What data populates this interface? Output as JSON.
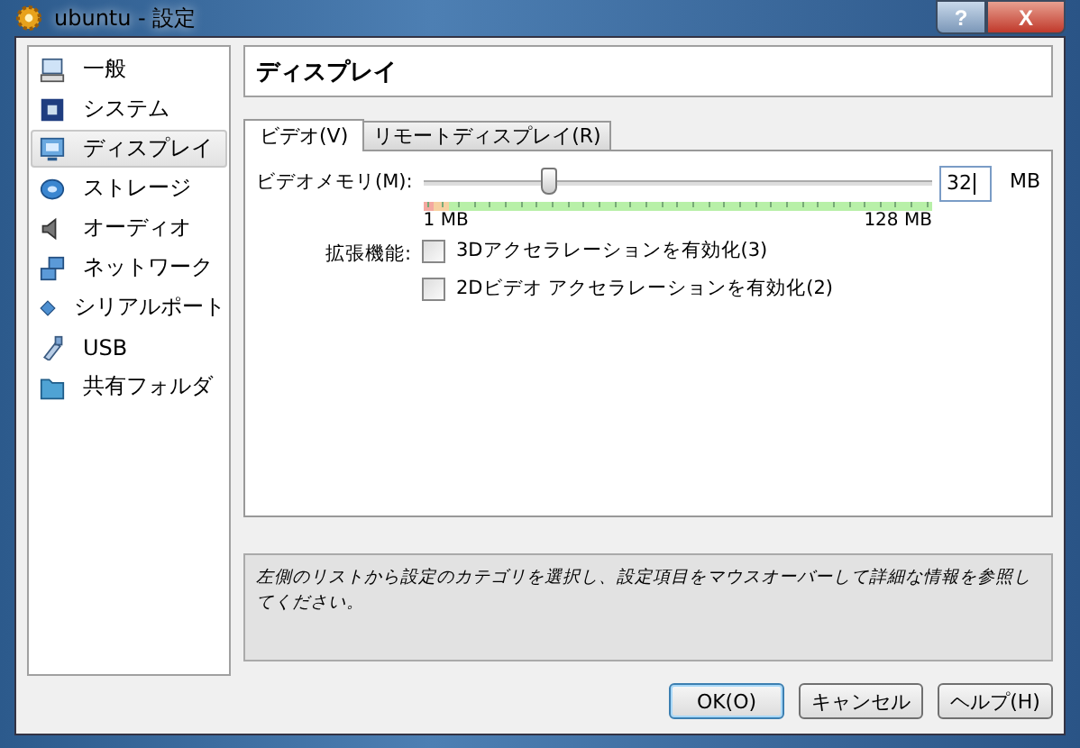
{
  "window": {
    "title": "ubuntu - 設定"
  },
  "title_buttons": [
    "?",
    "X"
  ],
  "sidebar": {
    "items": [
      {
        "label": "一般",
        "kind": "general",
        "selected": false
      },
      {
        "label": "システム",
        "kind": "system",
        "selected": false
      },
      {
        "label": "ディスプレイ",
        "kind": "display",
        "selected": true
      },
      {
        "label": "ストレージ",
        "kind": "storage",
        "selected": false
      },
      {
        "label": "オーディオ",
        "kind": "audio",
        "selected": false
      },
      {
        "label": "ネットワーク",
        "kind": "network",
        "selected": false
      },
      {
        "label": "シリアルポート",
        "kind": "serial",
        "selected": false
      },
      {
        "label": "USB",
        "kind": "usb",
        "selected": false
      },
      {
        "label": "共有フォルダ",
        "kind": "folder",
        "selected": false
      }
    ]
  },
  "page_title": "ディスプレイ",
  "tabs": [
    {
      "label": "ビデオ(V)",
      "selected": true
    },
    {
      "label": "リモートディスプレイ(R)",
      "selected": false
    }
  ],
  "video_memory": {
    "label": "ビデオメモリ(M):",
    "level": 0.25,
    "value": "32",
    "unit": "MB",
    "min_label": "1 MB",
    "max_label": "128 MB"
  },
  "extended": {
    "label": "拡張機能:",
    "options": [
      {
        "label": "3Dアクセラレーションを有効化(3)",
        "checked": false
      },
      {
        "label": "2Dビデオ アクセラレーションを有効化(2)",
        "checked": false
      }
    ]
  },
  "description": "左側のリストから設定のカテゴリを選択し、設定項目をマウスオーバーして詳細な情報を参照してください。",
  "buttons": [
    {
      "label": "OK(O)",
      "kind": "default"
    },
    {
      "label": "キャンセル",
      "kind": "normal"
    },
    {
      "label": "ヘルプ(H)",
      "kind": "normal"
    }
  ]
}
